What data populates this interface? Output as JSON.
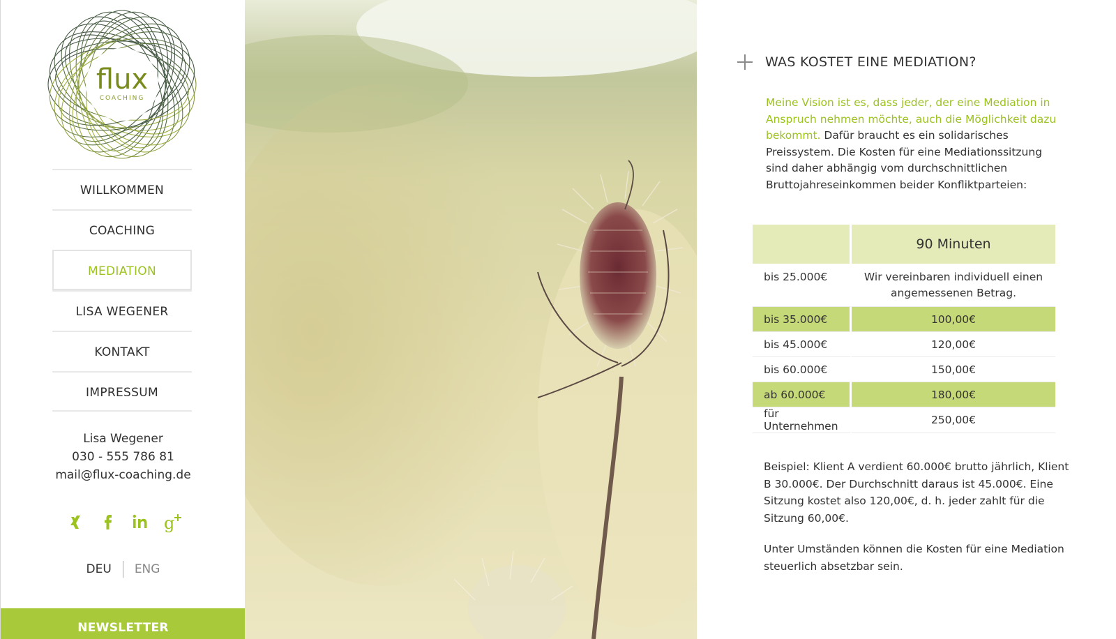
{
  "brand": {
    "logo_word": "flux",
    "logo_sub": "COACHING",
    "accent_color": "#9cc21f",
    "newsletter_color": "#a8c93a"
  },
  "nav": {
    "items": [
      {
        "label": "WILLKOMMEN",
        "active": false
      },
      {
        "label": "COACHING",
        "active": false
      },
      {
        "label": "MEDIATION",
        "active": true
      },
      {
        "label": "LISA WEGENER",
        "active": false
      },
      {
        "label": "KONTAKT",
        "active": false
      },
      {
        "label": "IMPRESSUM",
        "active": false
      }
    ]
  },
  "contact": {
    "name": "Lisa Wegener",
    "phone": "030 - 555 786 81",
    "email": "mail@flux-coaching.de"
  },
  "social": {
    "icons": [
      "xing-icon",
      "facebook-icon",
      "linkedin-icon",
      "google-plus-icon"
    ]
  },
  "language": {
    "current": "DEU",
    "other": "ENG"
  },
  "newsletter": {
    "label": "NEWSLETTER"
  },
  "photo": {
    "subject": "teasel-plant-photo"
  },
  "main": {
    "heading": "WAS KOSTET EINE MEDIATION?",
    "intro_highlight": "Meine Vision ist es, dass jeder, der eine Mediation in Anspruch nehmen möchte, auch die Möglichkeit dazu bekommt.",
    "intro_rest": " Dafür braucht es ein solidarisches Preissystem. Die Kosten für eine Mediationssitzung sind daher abhängig vom durchschnittlichen Bruttojahreseinkommen beider Konfliktparteien:",
    "table": {
      "header": "90 Minuten",
      "rows": [
        {
          "income": "bis 25.000€",
          "price": "Wir vereinbaren individuell einen angemessenen Betrag.",
          "highlight": false
        },
        {
          "income": "bis 35.000€",
          "price": "100,00€",
          "highlight": true
        },
        {
          "income": "bis 45.000€",
          "price": "120,00€",
          "highlight": false
        },
        {
          "income": "bis 60.000€",
          "price": "150,00€",
          "highlight": false
        },
        {
          "income": "ab 60.000€",
          "price": "180,00€",
          "highlight": true
        },
        {
          "income": "für Unternehmen",
          "price": "250,00€",
          "highlight": false
        }
      ]
    },
    "example": "Beispiel: Klient A verdient 60.000€ brutto jährlich, Klient B 30.000€. Der Durchschnitt daraus ist 45.000€. Eine Sitzung kostet also 120,00€, d. h. jeder zahlt für die Sitzung 60,00€.",
    "note": "Unter Umständen können die Kosten für eine Mediation steuerlich absetzbar sein."
  }
}
